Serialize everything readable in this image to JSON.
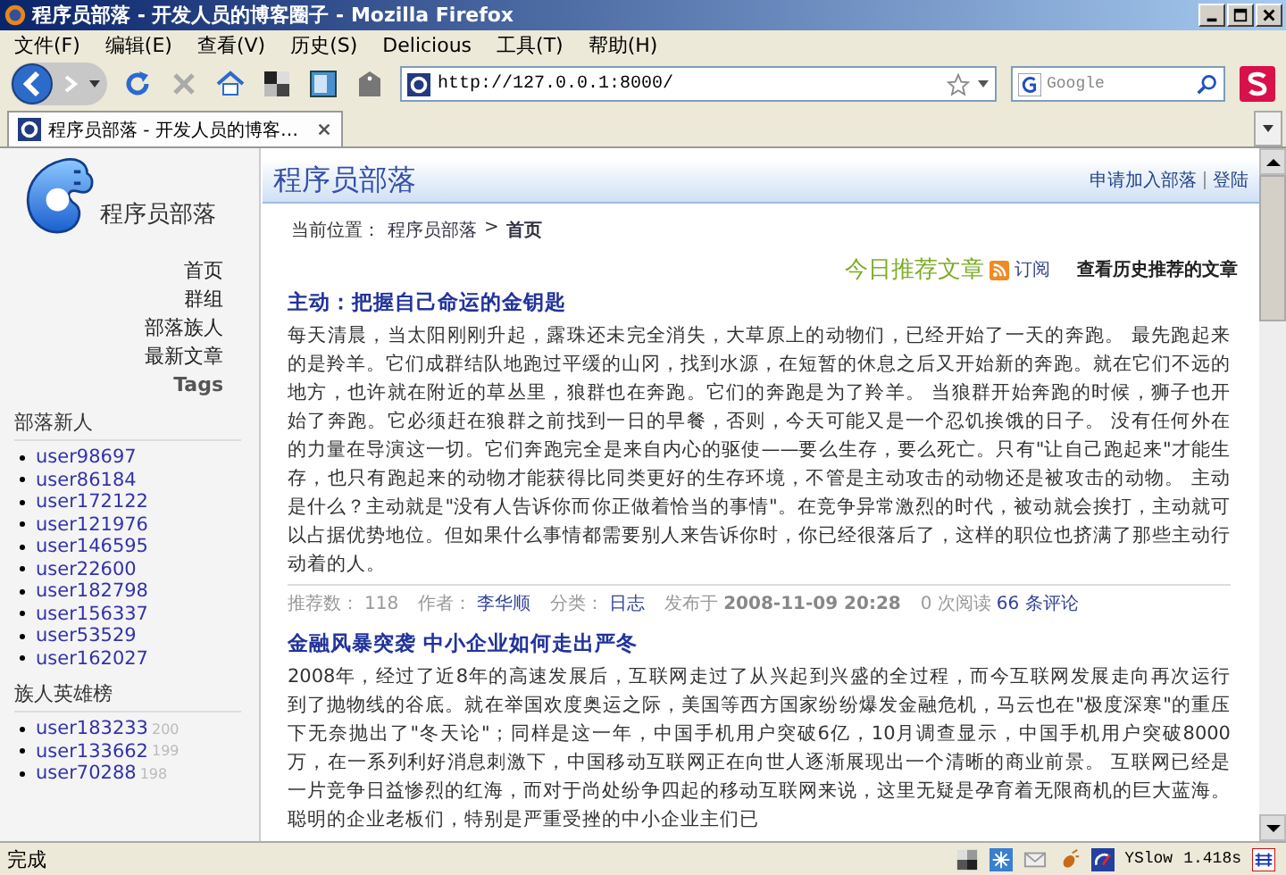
{
  "window": {
    "title": "程序员部落 - 开发人员的博客圈子 - Mozilla Firefox"
  },
  "menu": [
    "文件(F)",
    "编辑(E)",
    "查看(V)",
    "历史(S)",
    "Delicious",
    "工具(T)",
    "帮助(H)"
  ],
  "toolbar": {
    "url": "http://127.0.0.1:8000/",
    "search_placeholder": "Google"
  },
  "tabs": [
    {
      "label": "程序员部落 - 开发人员的博客…",
      "selected": true
    }
  ],
  "sidebar": {
    "logo_text": "程序员部落",
    "nav": [
      {
        "label": "首页"
      },
      {
        "label": "群组"
      },
      {
        "label": "部落族人"
      },
      {
        "label": "最新文章"
      },
      {
        "label": "Tags"
      }
    ],
    "newcomers": {
      "title": "部落新人",
      "users": [
        "user98697",
        "user86184",
        "user172122",
        "user121976",
        "user146595",
        "user22600",
        "user182798",
        "user156337",
        "user53529",
        "user162027"
      ]
    },
    "heroes": {
      "title": "族人英雄榜",
      "users": [
        {
          "name": "user183233",
          "count": "200"
        },
        {
          "name": "user133662",
          "count": "199"
        },
        {
          "name": "user70288",
          "count": "198"
        }
      ]
    }
  },
  "header": {
    "title": "程序员部落",
    "links": [
      "申请加入部落",
      "登陆"
    ]
  },
  "breadcrumb": {
    "label": "当前位置：",
    "separator": ">",
    "items": [
      "程序员部落",
      "首页"
    ]
  },
  "recommend": {
    "title": "今日推荐文章",
    "subscribe": "订阅",
    "history": "查看历史推荐的文章"
  },
  "articles": [
    {
      "title": "主动：把握自己命运的金钥匙",
      "body": "每天清晨，当太阳刚刚升起，露珠还未完全消失，大草原上的动物们，已经开始了一天的奔跑。 最先跑起来的是羚羊。它们成群结队地跑过平缓的山冈，找到水源，在短暂的休息之后又开始新的奔跑。就在它们不远的地方，也许就在附近的草丛里，狼群也在奔跑。它们的奔跑是为了羚羊。 当狼群开始奔跑的时候，狮子也开始了奔跑。它必须赶在狼群之前找到一日的早餐，否则，今天可能又是一个忍饥挨饿的日子。 没有任何外在的力量在导演这一切。它们奔跑完全是来自内心的驱使——要么生存，要么死亡。只有\"让自己跑起来\"才能生存，也只有跑起来的动物才能获得比同类更好的生存环境，不管是主动攻击的动物还是被攻击的动物。 主动是什么？主动就是\"没有人告诉你而你正做着恰当的事情\"。在竞争异常激烈的时代，被动就会挨打，主动就可以占据优势地位。但如果什么事情都需要别人来告诉你时，你已经很落后了，这样的职位也挤满了那些主动行动着的人。",
      "meta": {
        "votes_label": "推荐数：",
        "votes": "118",
        "author_label": "作者：",
        "author": "李华顺",
        "category_label": "分类：",
        "category": "日志",
        "date_label": "发布于",
        "date": "2008-11-09 20:28",
        "reads": "0 次阅读",
        "comments": "66 条评论"
      }
    },
    {
      "title": "金融风暴突袭 中小企业如何走出严冬",
      "body": "2008年，经过了近8年的高速发展后，互联网走过了从兴起到兴盛的全过程，而今互联网发展走向再次运行到了抛物线的谷底。就在举国欢度奥运之际，美国等西方国家纷纷爆发金融危机，马云也在\"极度深寒\"的重压下无奈抛出了\"冬天论\"；同样是这一年，中国手机用户突破6亿，10月调查显示，中国手机用户突破8000万，在一系列利好消息刺激下，中国移动互联网正在向世人逐渐展现出一个清晰的商业前景。 互联网已经是一片竞争日益惨烈的红海，而对于尚处纷争四起的移动互联网来说，这里无疑是孕育着无限商机的巨大蓝海。聪明的企业老板们，特别是严重受挫的中小企业主们已"
    }
  ],
  "status_bar": {
    "text": "完成",
    "yslow": "YSlow",
    "time": "1.418s"
  }
}
